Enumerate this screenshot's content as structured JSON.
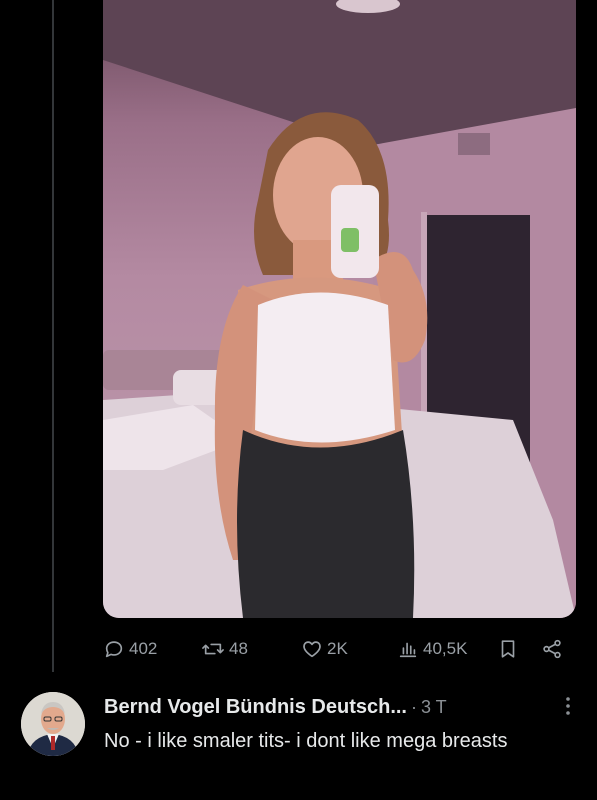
{
  "post": {
    "stats": {
      "replies": "402",
      "reposts": "48",
      "likes": "2K",
      "views": "40,5K"
    }
  },
  "icons": {
    "reply": "reply-bubble-icon",
    "repost": "repost-arrows-icon",
    "like": "heart-icon",
    "views": "bar-chart-icon",
    "bookmark": "bookmark-icon",
    "share": "share-icon",
    "more": "more-vertical-icon"
  },
  "reply": {
    "author": "Bernd Vogel Bündnis Deutsch...",
    "separator": "·",
    "time": "3 T",
    "text": "No - i like smaler tits- i dont like mega breasts"
  },
  "colors": {
    "background": "#000000",
    "text": "#e7e9ea",
    "muted": "#9aa0a6",
    "thread_line": "#333639"
  }
}
